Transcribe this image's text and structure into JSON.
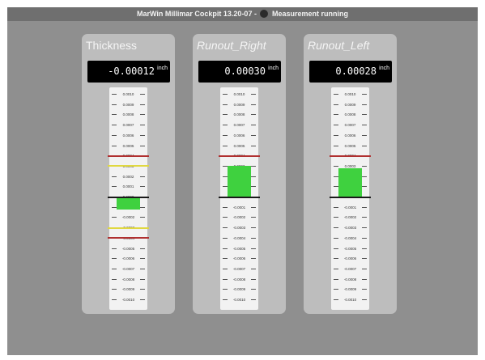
{
  "window": {
    "title": "MarWin Millimar Cockpit 13.20-07 -",
    "status": "Measurement running"
  },
  "colors": {
    "background": "#8f8f8f",
    "panel": "#bdbdbd",
    "bar": "#3fd13f",
    "tolerance_limit": "#b03030",
    "warning_limit": "#e0d840",
    "zero_line": "#1a1a1a"
  },
  "scale_labels": [
    "0.0010",
    "0.0009",
    "0.0008",
    "0.0007",
    "0.0006",
    "0.0005",
    "0.0004",
    "0.0003",
    "0.0002",
    "0.0001",
    "0.0000",
    "-0.0001",
    "-0.0002",
    "-0.0003",
    "-0.0004",
    "-0.0005",
    "-0.0006",
    "-0.0007",
    "-0.0008",
    "-0.0009",
    "-0.0010"
  ],
  "panels": [
    {
      "title": "Thickness",
      "italic": false,
      "value": "-0.00012",
      "unit": "inch",
      "measured": -0.00012,
      "tolerance_limit": 0.0004,
      "warning_limit": 0.0003
    },
    {
      "title": "Runout_Right",
      "italic": true,
      "value": "0.00030",
      "unit": "inch",
      "measured": 0.0003,
      "tolerance_limit": 0.0004,
      "warning_limit": null
    },
    {
      "title": "Runout_Left",
      "italic": true,
      "value": "0.00028",
      "unit": "inch",
      "measured": 0.00028,
      "tolerance_limit": 0.0004,
      "warning_limit": null
    }
  ]
}
